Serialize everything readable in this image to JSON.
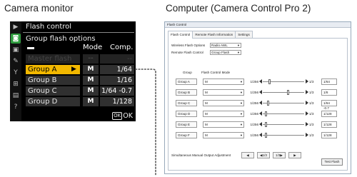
{
  "captions": {
    "camera_monitor": "Camera monitor",
    "computer": "Computer (Camera Control Pro 2)"
  },
  "camera": {
    "title": "Flash control",
    "subtitle": "Group flash options",
    "col_mode": "Mode",
    "col_comp": "Comp.",
    "rows": [
      {
        "label": "Master flash",
        "mode": "--",
        "comp": "--",
        "state": "dim"
      },
      {
        "label": "Group A",
        "mode": "M",
        "comp": "1/64",
        "state": "selected"
      },
      {
        "label": "Group B",
        "mode": "M",
        "comp": "1/16",
        "state": "normal"
      },
      {
        "label": "Group C",
        "mode": "M",
        "comp": "1/64 -0.7",
        "state": "normal"
      },
      {
        "label": "Group D",
        "mode": "M",
        "comp": "1/128",
        "state": "normal"
      }
    ],
    "ok_icon": "OK",
    "ok_label": "OK",
    "colors": {
      "selected": "#f2b800",
      "active_tab": "#2e9c3e"
    }
  },
  "computer": {
    "window_title": "Flash Control",
    "tabs": [
      "Flash Control",
      "Remote Flash Information",
      "Settings"
    ],
    "wireless_label": "Wireless Flash Options",
    "wireless_value": "Radio AWL",
    "remote_label": "Remote Flash Control",
    "remote_value": "Group Flash",
    "group_header": "Group",
    "mode_header": "Flash Control Mode",
    "groups": [
      {
        "name": "Group A",
        "mode": "M",
        "value": "1/256",
        "step": "1/3",
        "comp": "1/64",
        "level": 0.15
      },
      {
        "name": "Group B",
        "mode": "M",
        "value": "1/256",
        "step": "1/3",
        "comp": "1/8",
        "level": 0.62
      },
      {
        "name": "Group C",
        "mode": "M",
        "value": "1/256",
        "step": "1/3",
        "comp": "1/64 -0.7",
        "level": 0.1
      },
      {
        "name": "Group D",
        "mode": "M",
        "value": "1/256",
        "step": "1/3",
        "comp": "1/128",
        "level": 0.05
      },
      {
        "name": "Group E",
        "mode": "M",
        "value": "1/256",
        "step": "1/3",
        "comp": "1/128",
        "level": 0.05
      },
      {
        "name": "Group F",
        "mode": "M",
        "value": "1/256",
        "step": "1/3",
        "comp": "1/128",
        "level": 0.05
      }
    ],
    "simul_label": "Simultaneous Manual Output Adjustment",
    "simul_buttons": [
      "◀",
      "◀1/3",
      "1/3▶",
      "▶"
    ],
    "test_flash": "Test Flash"
  }
}
